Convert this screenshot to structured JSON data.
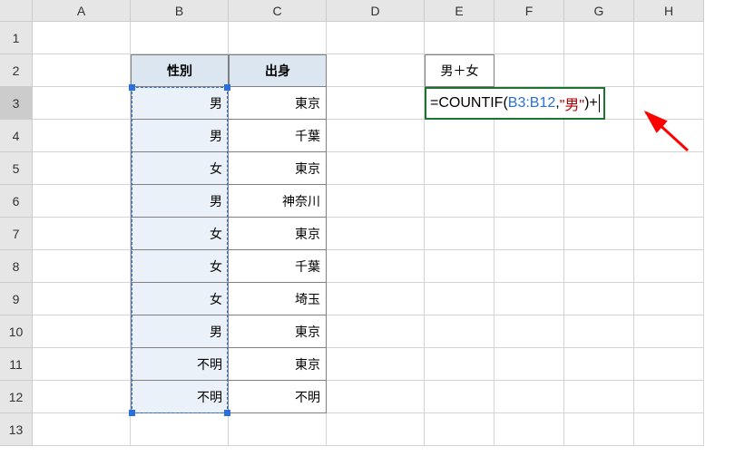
{
  "columns": [
    "A",
    "B",
    "C",
    "D",
    "E",
    "F",
    "G",
    "H"
  ],
  "col_widths": {
    "A": 108,
    "B": 108,
    "C": 108,
    "D": 108,
    "E": 77,
    "F": 77,
    "G": 77,
    "H": 77
  },
  "row_count": 13,
  "table": {
    "headers": {
      "b": "性別",
      "c": "出身"
    },
    "rows": [
      {
        "b": "男",
        "c": "東京"
      },
      {
        "b": "男",
        "c": "千葉"
      },
      {
        "b": "女",
        "c": "東京"
      },
      {
        "b": "男",
        "c": "神奈川"
      },
      {
        "b": "女",
        "c": "東京"
      },
      {
        "b": "女",
        "c": "千葉"
      },
      {
        "b": "女",
        "c": "埼玉"
      },
      {
        "b": "男",
        "c": "東京"
      },
      {
        "b": "不明",
        "c": "東京"
      },
      {
        "b": "不明",
        "c": "不明"
      }
    ]
  },
  "e2": "男＋女",
  "formula": {
    "prefix": "=",
    "fn": "COUNTIF",
    "open": "(",
    "ref": "B3:B12",
    "sep": ",",
    "arg": "\"男\"",
    "close": ")",
    "plus": "+"
  },
  "active_row": 3,
  "chart_data": {
    "type": "table",
    "title": "",
    "columns": [
      "性別",
      "出身"
    ],
    "rows": [
      [
        "男",
        "東京"
      ],
      [
        "男",
        "千葉"
      ],
      [
        "女",
        "東京"
      ],
      [
        "男",
        "神奈川"
      ],
      [
        "女",
        "東京"
      ],
      [
        "女",
        "千葉"
      ],
      [
        "女",
        "埼玉"
      ],
      [
        "男",
        "東京"
      ],
      [
        "不明",
        "東京"
      ],
      [
        "不明",
        "不明"
      ]
    ],
    "summary_label": "男＋女",
    "formula_text": "=COUNTIF(B3:B12,\"男\")+"
  }
}
